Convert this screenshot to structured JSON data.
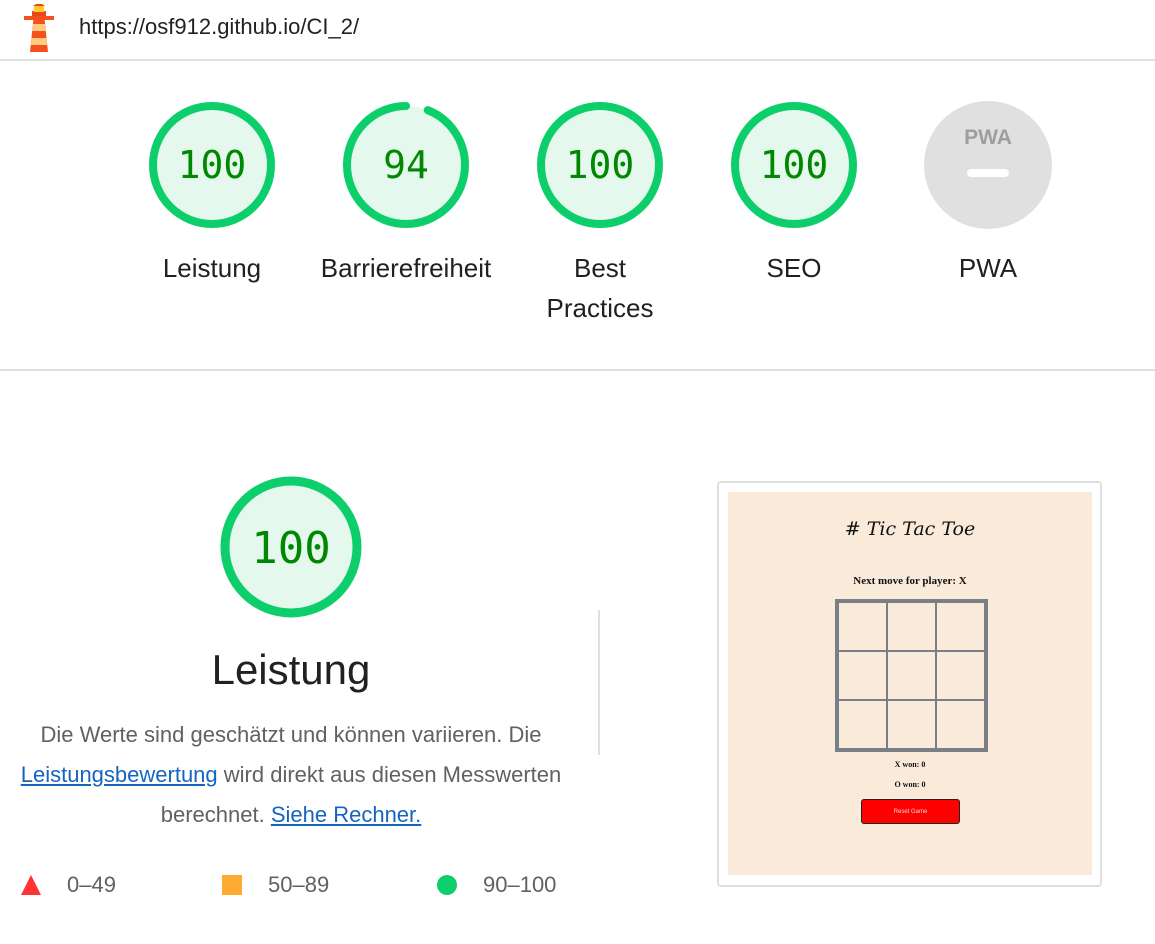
{
  "header": {
    "url": "https://osf912.github.io/CI_2/"
  },
  "gauges": [
    {
      "score": "100",
      "label": "Leistung",
      "value": 100
    },
    {
      "score": "94",
      "label": "Barrierefreiheit",
      "value": 94
    },
    {
      "score": "100",
      "label": "Best Practices",
      "value": 100
    },
    {
      "score": "100",
      "label": "SEO",
      "value": 100
    },
    {
      "score": "PWA",
      "label": "PWA",
      "value": null
    }
  ],
  "performance": {
    "score": "100",
    "title": "Leistung",
    "desc_part1": "Die Werte sind geschätzt und können variieren. Die",
    "link_scoring": "Leistungsbewertung",
    "desc_part2": "wird direkt aus diesen Messwerten berechnet.",
    "link_calculator": "Siehe Rechner."
  },
  "legend": [
    {
      "range": "0–49",
      "color": "#ff3333",
      "shape": "triangle-icon"
    },
    {
      "range": "50–89",
      "color": "#ffaa33",
      "shape": "square-icon"
    },
    {
      "range": "90–100",
      "color": "#0cce6b",
      "shape": "circle-icon"
    }
  ],
  "screenshot": {
    "title": "# Tic Tac Toe",
    "next_move": "Next move for player: X",
    "x_won": "X won: 0",
    "o_won": "O won: 0",
    "reset_label": "Reset Game"
  },
  "colors": {
    "pass": "#0cce6b",
    "pass_text": "#008800",
    "pass_fill": "#e5f8ee",
    "average": "#ffaa33",
    "fail": "#ff3333",
    "link": "#1565c0",
    "pwa_gray": "#e0e0e0"
  }
}
